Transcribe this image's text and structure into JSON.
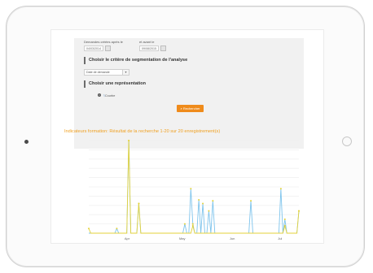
{
  "form": {
    "from_label": "Demandes créées après le",
    "from_value": "04/03/2014",
    "to_label": "et avant le",
    "to_value": "09/08/2015",
    "segmentation_title": "Choisir le critère de segmentation de l'analyse",
    "segmentation_value": "Date de demande",
    "representation_title": "Choisir une représentation",
    "representation_option": "Courbe",
    "search_button": "Rechercher"
  },
  "results": {
    "title": "Indicateurs formation: Résultat de la recherche 1-20 sur 20 enregistrement(s)"
  },
  "colors": {
    "accent": "#ef8b1b",
    "title": "#f0a020",
    "series_blue": "#7ec4ec",
    "series_yellow": "#e3d23a"
  },
  "chart_data": {
    "type": "line",
    "x_tick_labels": [
      "Apr",
      "May",
      "Jun",
      "Jul"
    ],
    "ylim": [
      0,
      10
    ],
    "grid": true,
    "series": [
      {
        "color": "#7ec4ec",
        "values": [
          0,
          0,
          0,
          0,
          0,
          0,
          0,
          0,
          0,
          0,
          0,
          0,
          0,
          0,
          0.5,
          0,
          0,
          0,
          0,
          0,
          10,
          0,
          0,
          0,
          0,
          3.2,
          0,
          0,
          0,
          0,
          0,
          0,
          0,
          0,
          0,
          0,
          0,
          0,
          0,
          0,
          0,
          0,
          0,
          0,
          0,
          0,
          0,
          0,
          1,
          0,
          0,
          4.8,
          1,
          0,
          0,
          3.6,
          0,
          3.2,
          0,
          0,
          2.4,
          0,
          3.5,
          0,
          0,
          0,
          0,
          0,
          0,
          0,
          0,
          0,
          0,
          0,
          0,
          0,
          0,
          0,
          0,
          0,
          0,
          3.5,
          0,
          0,
          0,
          0,
          0,
          0,
          0,
          0,
          0,
          0,
          0,
          0,
          0,
          0,
          4.8,
          0,
          1.5,
          0,
          0,
          0,
          0,
          0,
          0,
          2.4
        ]
      },
      {
        "color": "#e3d23a",
        "values": [
          0.5,
          0,
          0,
          0,
          0,
          0,
          0,
          0,
          0,
          0,
          0,
          0,
          0,
          0,
          0,
          0,
          0,
          0,
          0,
          0,
          10,
          0,
          0,
          0,
          0,
          3.2,
          0,
          0,
          0,
          0,
          0,
          0,
          0,
          0,
          0,
          0,
          0,
          0,
          0,
          0,
          0,
          0,
          0,
          0,
          0,
          0,
          0,
          0,
          0,
          0,
          0,
          0,
          0.8,
          0,
          0,
          0,
          0,
          0,
          0,
          0,
          0,
          0,
          0,
          0,
          0,
          0,
          0,
          0,
          0,
          0,
          0,
          0,
          0,
          0,
          0,
          0,
          0,
          0,
          0,
          0,
          0,
          0,
          0,
          0,
          0,
          0,
          0,
          0,
          0,
          0,
          0,
          0,
          0,
          0,
          0,
          0,
          0,
          0,
          0.8,
          0,
          0,
          0,
          0,
          0,
          0,
          2.4
        ]
      }
    ]
  }
}
